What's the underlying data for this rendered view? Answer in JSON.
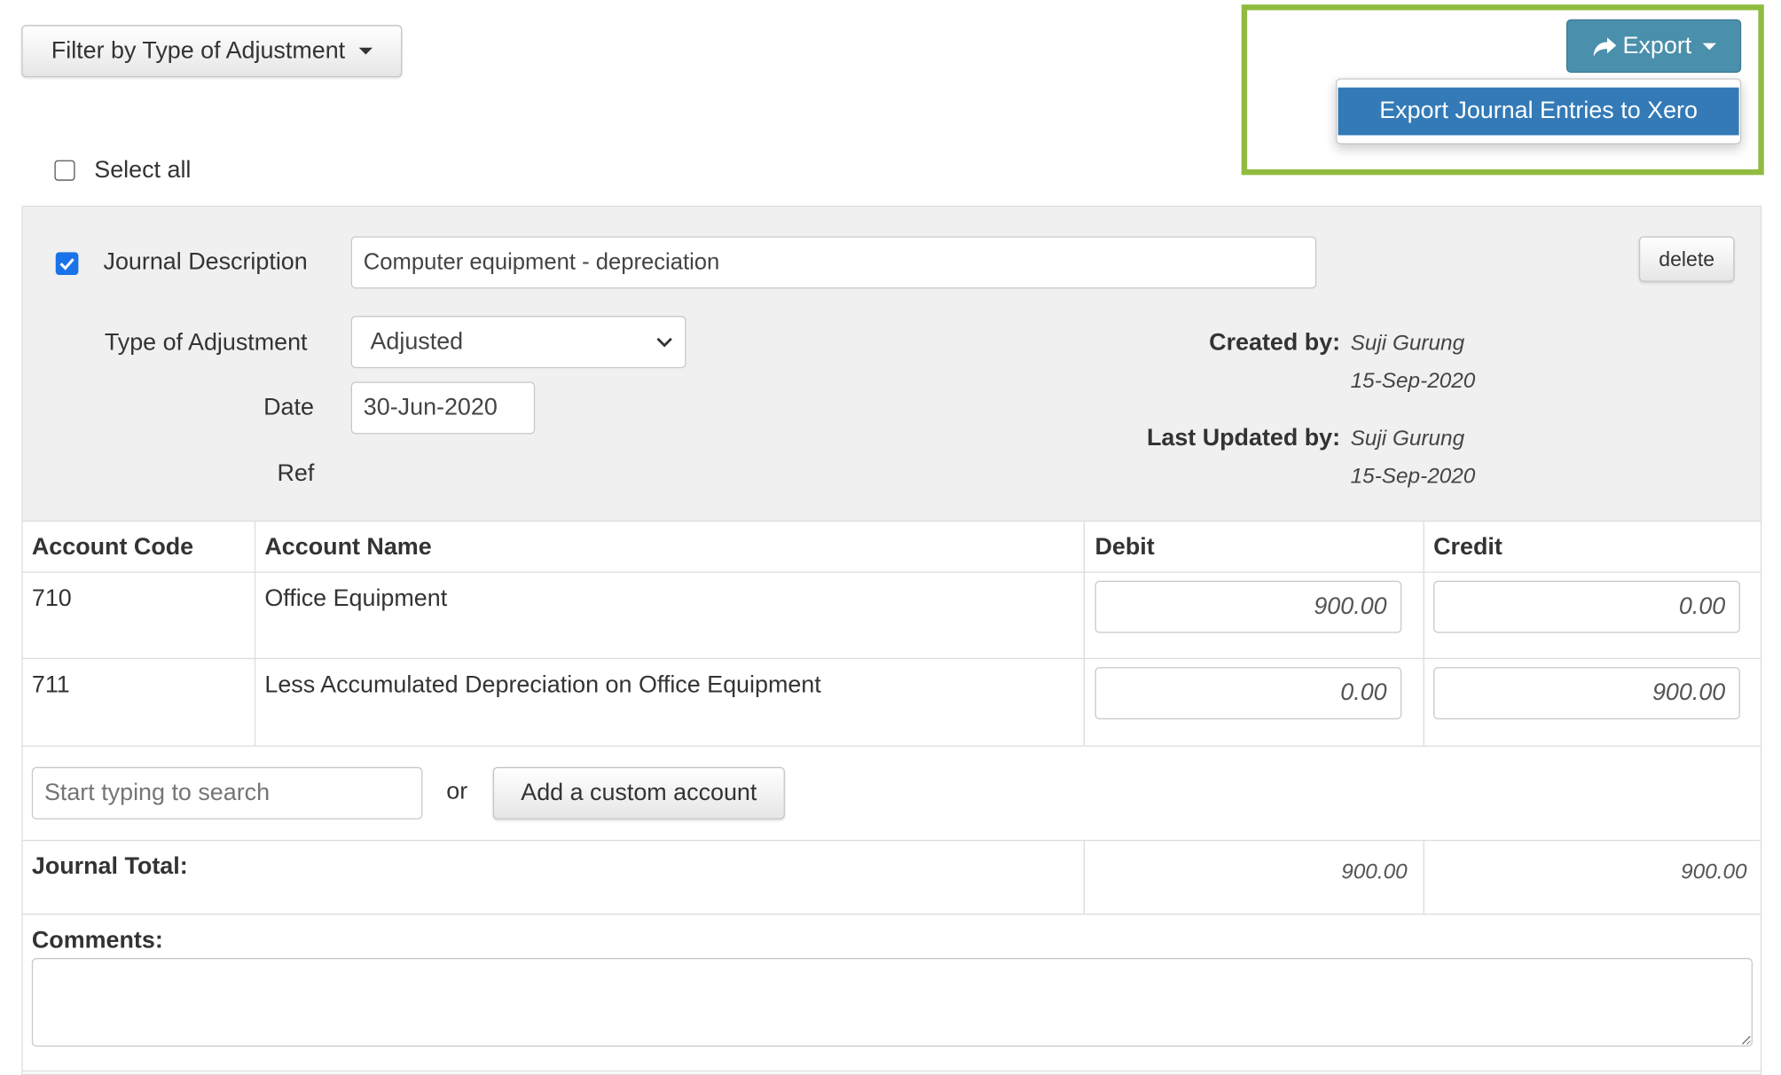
{
  "filter": {
    "label": "Filter by Type of Adjustment"
  },
  "export": {
    "button_label": "Export",
    "menu_item": "Export Journal Entries to Xero"
  },
  "select_all": {
    "label": "Select all",
    "checked": false
  },
  "journal": {
    "checked": true,
    "description_label": "Journal Description",
    "description_value": "Computer equipment - depreciation",
    "delete_label": "delete",
    "type_label": "Type of Adjustment",
    "type_value": "Adjusted",
    "date_label": "Date",
    "date_value": "30-Jun-2020",
    "ref_label": "Ref",
    "created_by_label": "Created by:",
    "created_by_name": "Suji Gurung",
    "created_by_date": "15-Sep-2020",
    "updated_by_label": "Last Updated by:",
    "updated_by_name": "Suji Gurung",
    "updated_by_date": "15-Sep-2020"
  },
  "table": {
    "headers": [
      "Account Code",
      "Account Name",
      "Debit",
      "Credit"
    ],
    "rows": [
      {
        "code": "710",
        "name": "Office Equipment",
        "debit": "900.00",
        "credit": "0.00"
      },
      {
        "code": "711",
        "name": "Less Accumulated Depreciation on Office Equipment",
        "debit": "0.00",
        "credit": "900.00"
      }
    ],
    "search_placeholder": "Start typing to search",
    "or_text": "or",
    "add_custom_label": "Add a custom account",
    "total_label": "Journal Total:",
    "total_debit": "900.00",
    "total_credit": "900.00",
    "comments_label": "Comments:"
  },
  "colors": {
    "export_button": "#4a8fab",
    "menu_item_bg": "#337ab7",
    "highlight_border": "#8fbc3f",
    "checkbox_checked": "#1a73e8"
  },
  "icons": {
    "export": "share-arrow-icon",
    "dropdown": "caret-down-icon",
    "select": "chevron-down-icon"
  }
}
